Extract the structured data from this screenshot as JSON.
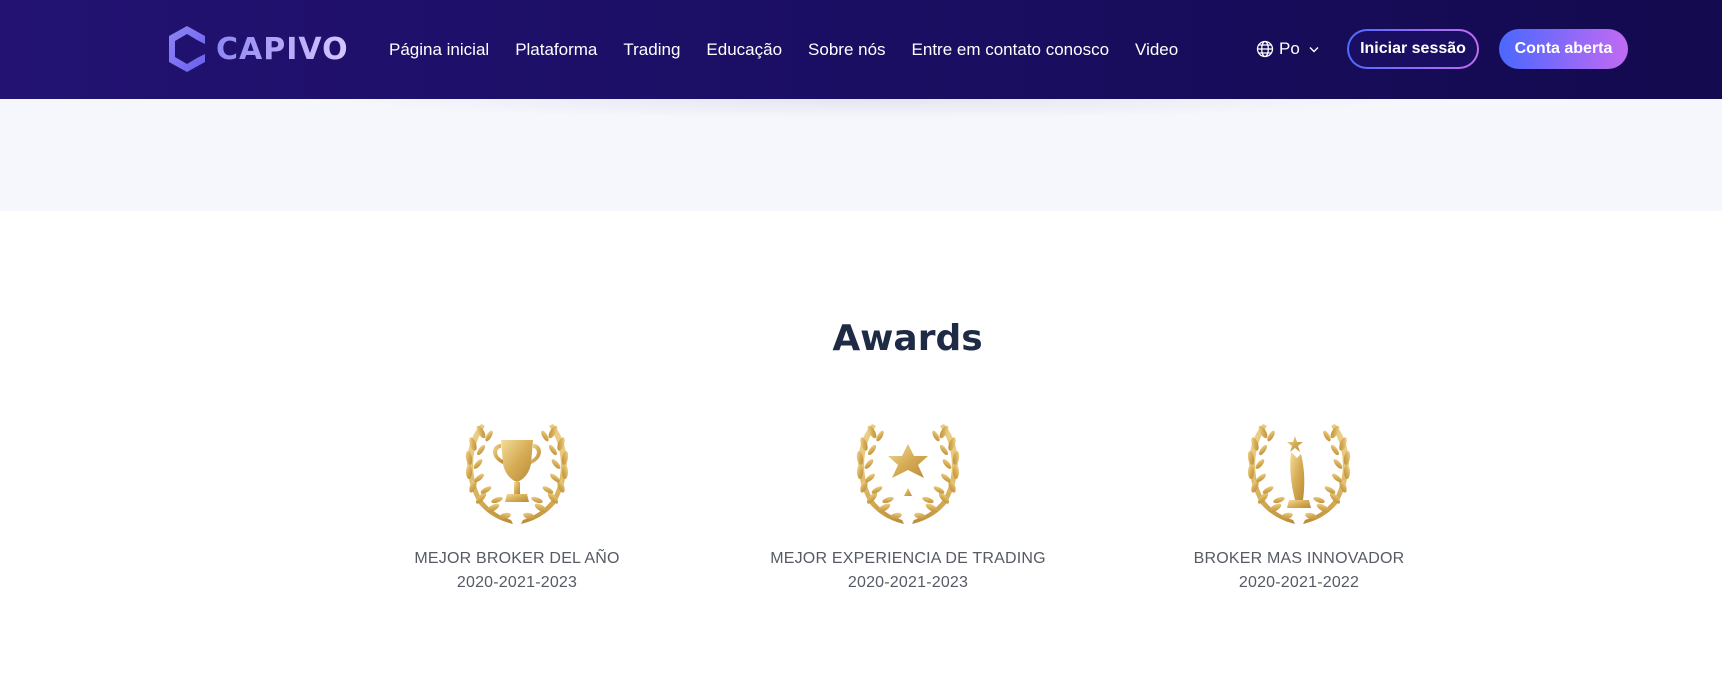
{
  "brand": {
    "logo_text": "CAPIVO"
  },
  "nav": {
    "items": [
      {
        "label": "Página inicial"
      },
      {
        "label": "Plataforma"
      },
      {
        "label": "Trading"
      },
      {
        "label": "Educação"
      },
      {
        "label": "Sobre nós"
      },
      {
        "label": "Entre em contato conosco"
      },
      {
        "label": "Video"
      }
    ]
  },
  "language": {
    "label": "Po",
    "icon": "globe-icon"
  },
  "actions": {
    "login_label": "Iniciar sessão",
    "open_account_label": "Conta aberta"
  },
  "awards": {
    "title": "Awards",
    "items": [
      {
        "name": "MEJOR BROKER DEL AÑO",
        "years": "2020-2021-2023",
        "icon": "trophy-laurel-icon"
      },
      {
        "name": "MEJOR EXPERIENCIA DE TRADING",
        "years": "2020-2021-2023",
        "icon": "star-laurel-icon"
      },
      {
        "name": "BROKER MAS INNOVADOR",
        "years": "2020-2021-2022",
        "icon": "statue-laurel-icon"
      }
    ]
  },
  "colors": {
    "header_bg_start": "#231272",
    "header_bg_end": "#130a4f",
    "accent_blue": "#4a68ff",
    "accent_purple": "#c26af3",
    "gold": "#d6ad56",
    "title_text": "#1f2a44",
    "body_text": "#555a64"
  }
}
